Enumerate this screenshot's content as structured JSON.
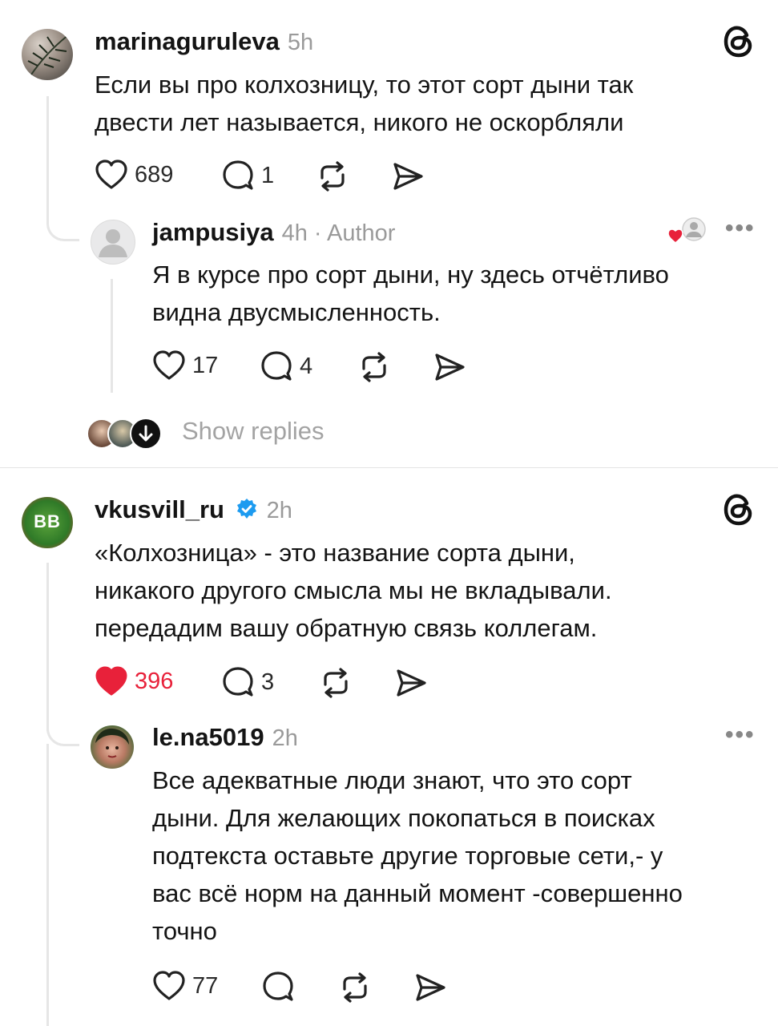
{
  "comments": [
    {
      "username": "marinaguruleva",
      "time": "5h",
      "text_lines": [
        "Если вы про колхозницу, то этот сорт дыни так",
        "двести лет называется, никого не оскорбляли"
      ],
      "likes": "689",
      "replies": "1",
      "liked": false,
      "icon": "threads-icon"
    },
    {
      "username": "jampusiya",
      "time": "4h",
      "author_tag": "· Author",
      "text_lines": [
        "Я в курсе про сорт дыни, ну здесь отчётливо",
        "видна двусмысленность."
      ],
      "likes": "17",
      "replies": "4",
      "liked": false
    },
    {
      "username": "vkusvill_ru",
      "time": "2h",
      "verified": true,
      "avatar_text": "BB",
      "text_lines": [
        "«Колхозница» - это название сорта дыни,",
        "никакого другого смысла мы не вкладывали.",
        "передадим вашу обратную связь коллегам."
      ],
      "likes": "396",
      "replies": "3",
      "liked": true,
      "icon": "threads-icon"
    },
    {
      "username": "le.na5019",
      "time": "2h",
      "text_lines": [
        "Все адекватные люди знают, что это сорт",
        "дыни. Для желающих покопаться в поисках",
        "подтекста оставьте другие торговые сети,- у",
        "вас всё норм на данный момент -совершенно",
        "точно"
      ],
      "likes": "77",
      "replies": "",
      "liked": false
    }
  ],
  "show_replies": "Show replies",
  "colors": {
    "like_red": "#e8213a",
    "verified_blue": "#1d9bf0",
    "muted": "#9a9a9a"
  }
}
